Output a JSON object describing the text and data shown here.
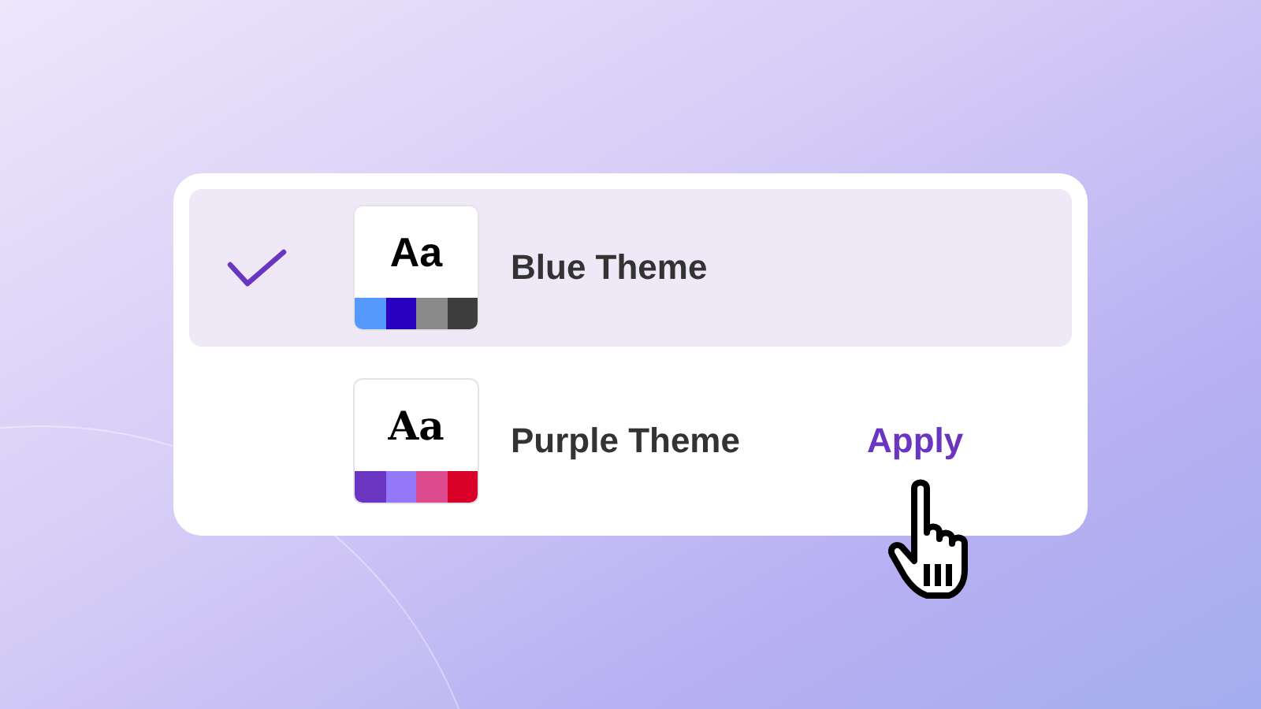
{
  "themes": [
    {
      "name": "Blue Theme",
      "selected": true,
      "sample": "Aa",
      "kind": "sans",
      "swatches": [
        {
          "color": "#5599ff"
        },
        {
          "color": "#2a00c0"
        },
        {
          "color": "#8a8a8a"
        },
        {
          "color": "#3e3e3e"
        }
      ]
    },
    {
      "name": "Purple Theme",
      "selected": false,
      "sample": "Aa",
      "kind": "serif",
      "swatches": [
        {
          "color": "#6a35c0"
        },
        {
          "color": "#9478fa"
        },
        {
          "color": "#dd4a8e"
        },
        {
          "color": "#d90027"
        }
      ],
      "action": "Apply"
    }
  ]
}
